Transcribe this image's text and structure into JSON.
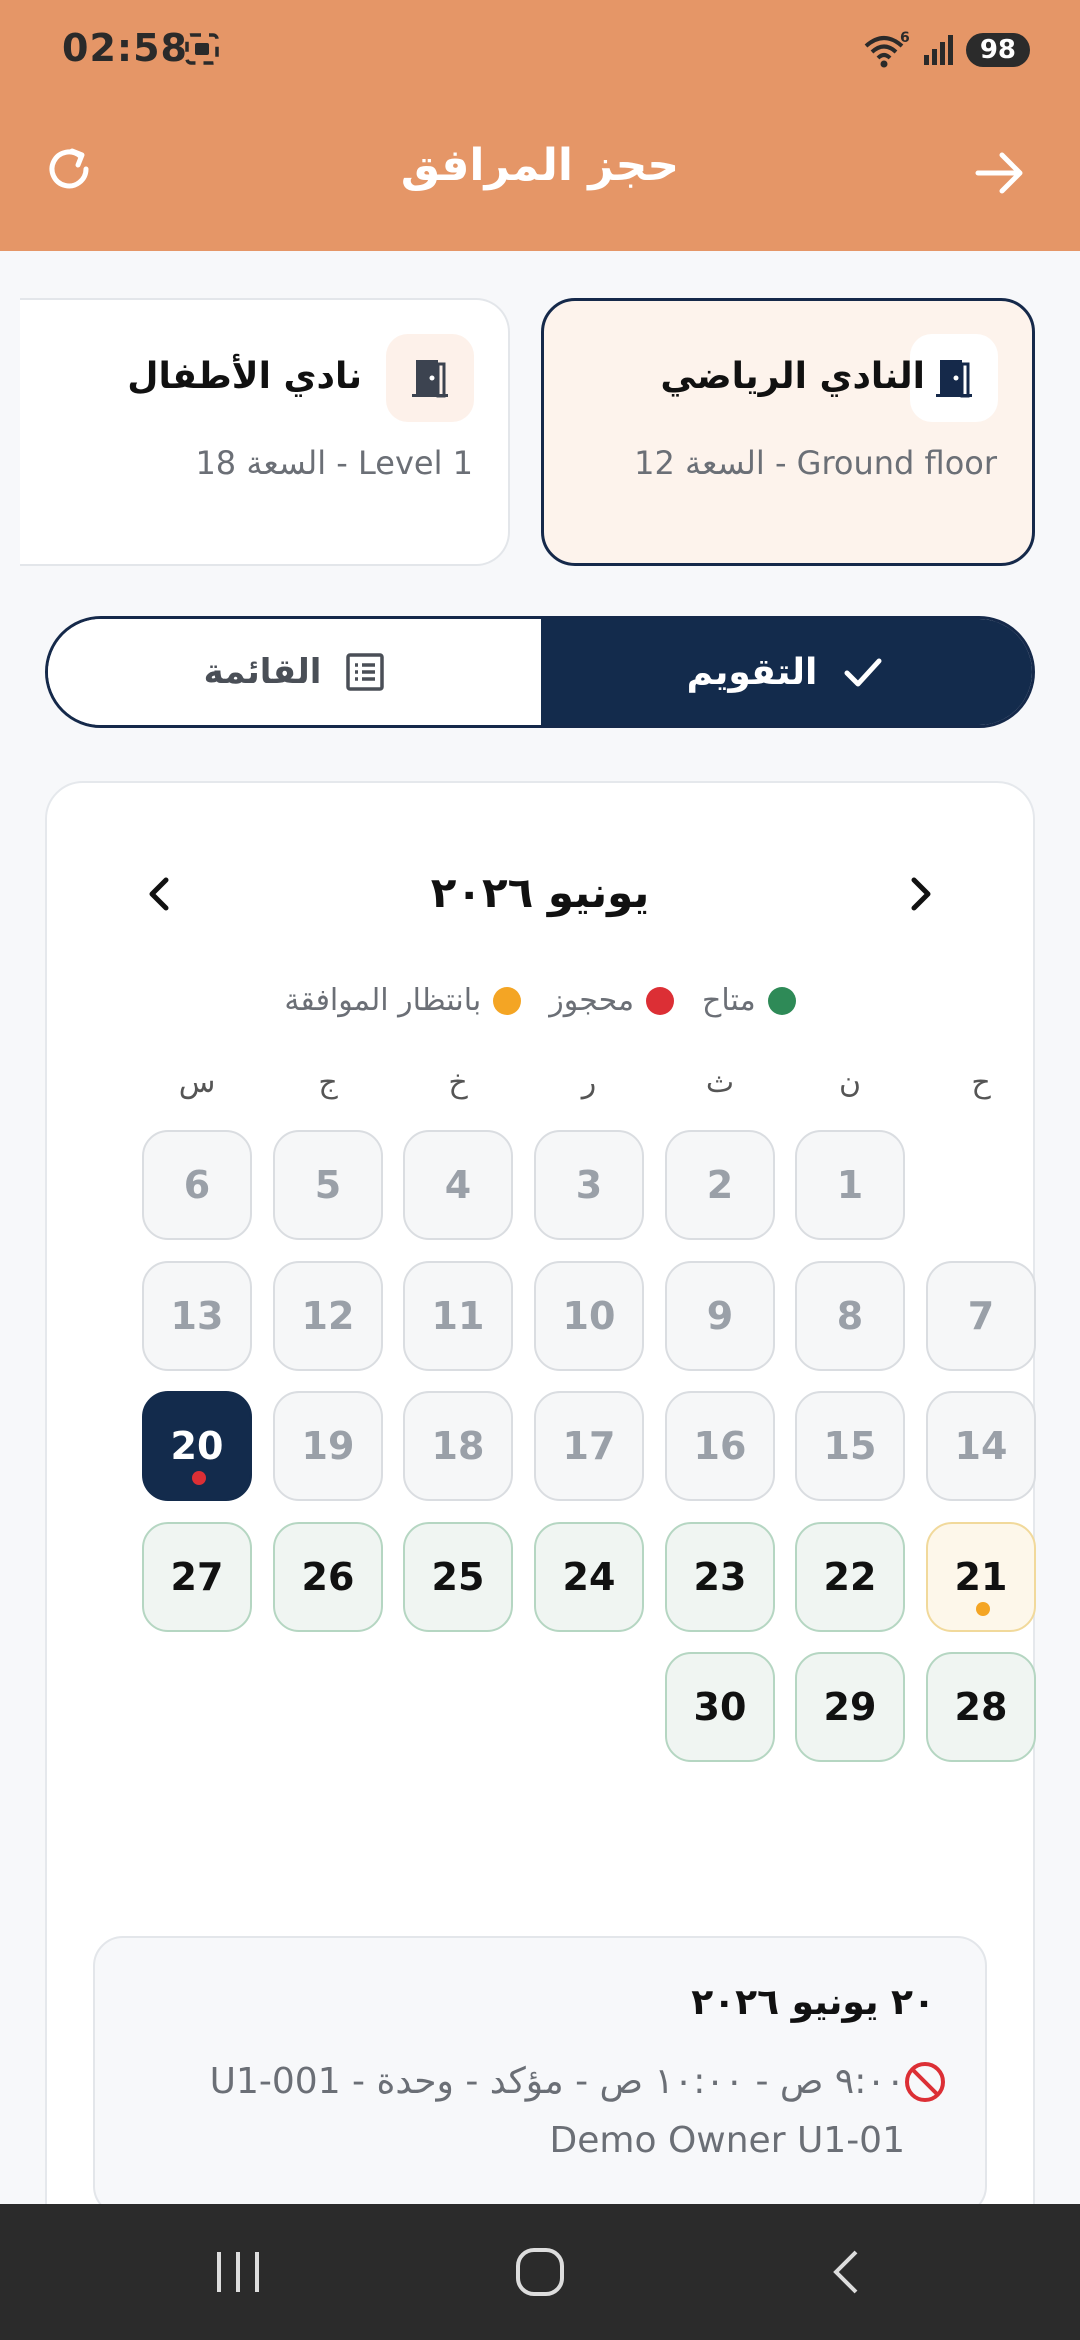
{
  "status_bar": {
    "time": "02:58",
    "battery": "98",
    "network": "6"
  },
  "header": {
    "title": "حجز المرافق"
  },
  "facilities": [
    {
      "name": "النادي الرياضي",
      "details": "Ground floor - السعة 12",
      "selected": true
    },
    {
      "name": "نادي الأطفال",
      "details": "Level 1 - السعة 18",
      "selected": false
    }
  ],
  "view_toggle": {
    "calendar_label": "التقويم",
    "list_label": "القائمة",
    "active": "calendar"
  },
  "calendar": {
    "month_title": "يونيو ٢٠٢٦",
    "legend": [
      {
        "label": "متاح",
        "color": "#2e8a57"
      },
      {
        "label": "محجوز",
        "color": "#dc2f35"
      },
      {
        "label": "بانتظار الموافقة",
        "color": "#f4a524"
      }
    ],
    "weekdays": [
      "ح",
      "ن",
      "ث",
      "ر",
      "خ",
      "ج",
      "س"
    ],
    "days": [
      {
        "day": "1",
        "state": "past"
      },
      {
        "day": "2",
        "state": "past"
      },
      {
        "day": "3",
        "state": "past"
      },
      {
        "day": "4",
        "state": "past"
      },
      {
        "day": "5",
        "state": "past"
      },
      {
        "day": "6",
        "state": "past"
      },
      {
        "day": "7",
        "state": "past"
      },
      {
        "day": "8",
        "state": "past"
      },
      {
        "day": "9",
        "state": "past"
      },
      {
        "day": "10",
        "state": "past"
      },
      {
        "day": "11",
        "state": "past"
      },
      {
        "day": "12",
        "state": "past"
      },
      {
        "day": "13",
        "state": "past"
      },
      {
        "day": "14",
        "state": "past"
      },
      {
        "day": "15",
        "state": "past"
      },
      {
        "day": "16",
        "state": "past"
      },
      {
        "day": "17",
        "state": "past"
      },
      {
        "day": "18",
        "state": "past"
      },
      {
        "day": "19",
        "state": "past"
      },
      {
        "day": "20",
        "state": "selected",
        "marker": "booked"
      },
      {
        "day": "21",
        "state": "pending",
        "marker": "pending"
      },
      {
        "day": "22",
        "state": "available"
      },
      {
        "day": "23",
        "state": "available"
      },
      {
        "day": "24",
        "state": "available"
      },
      {
        "day": "25",
        "state": "available"
      },
      {
        "day": "26",
        "state": "available"
      },
      {
        "day": "27",
        "state": "available"
      },
      {
        "day": "28",
        "state": "available"
      },
      {
        "day": "29",
        "state": "available"
      },
      {
        "day": "30",
        "state": "available"
      }
    ]
  },
  "booking": {
    "date": "٢٠ يونيو ٢٠٢٦",
    "details": "٩:٠٠ ص - ١٠:٠٠ ص - مؤكد - وحدة U1-001 - Demo Owner U1-01"
  },
  "colors": {
    "app_bar": "#e59667",
    "primary_navy": "#132b4c",
    "booked_red": "#dc2f35"
  }
}
